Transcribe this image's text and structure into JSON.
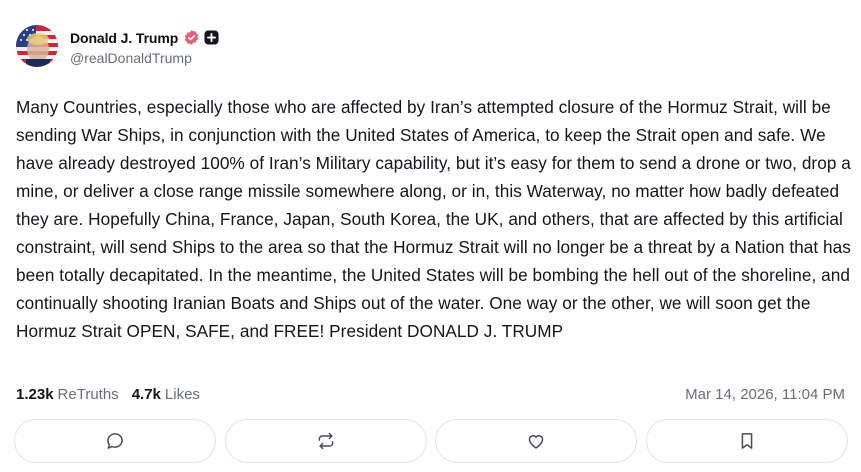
{
  "author": {
    "display_name": "Donald J. Trump",
    "handle": "@realDonaldTrump",
    "verified_icon": "verified-badge-icon",
    "plus_icon": "plus-badge-icon",
    "avatar_icon": "avatar-flag-portrait"
  },
  "post": {
    "text": "Many Countries, especially those who are affected by Iran’s attempted closure of the Hormuz Strait, will be sending War Ships, in conjunction with the United States of America, to keep the Strait open and safe. We have already destroyed 100% of Iran’s Military capability, but it’s easy for them to send a drone or two, drop a mine, or deliver a close range missile somewhere along, or in, this Waterway, no matter how badly defeated they are. Hopefully China, France, Japan, South Korea, the UK, and others, that are affected by this artificial constraint, will send Ships to the area so that the Hormuz Strait will no longer be a threat by a Nation that has been totally decapitated. In the meantime, the United States will be bombing the hell out of the shoreline, and continually shooting Iranian Boats and Ships out of the water. One way or the other, we will soon get the Hormuz Strait OPEN, SAFE, and FREE! President DONALD J. TRUMP"
  },
  "stats": {
    "retruths_count": "1.23k",
    "retruths_label": "ReTruths",
    "likes_count": "4.7k",
    "likes_label": "Likes",
    "timestamp": "Mar 14, 2026, 11:04 PM"
  },
  "actions": [
    {
      "name": "reply",
      "icon": "speech-bubble-icon"
    },
    {
      "name": "retruth",
      "icon": "repost-arrows-icon"
    },
    {
      "name": "like",
      "icon": "heart-icon"
    },
    {
      "name": "bookmark",
      "icon": "bookmark-icon"
    }
  ],
  "colors": {
    "verified": "#e8607a",
    "text": "#15161a",
    "muted": "#6b6e76",
    "border": "#e1e3e8"
  }
}
